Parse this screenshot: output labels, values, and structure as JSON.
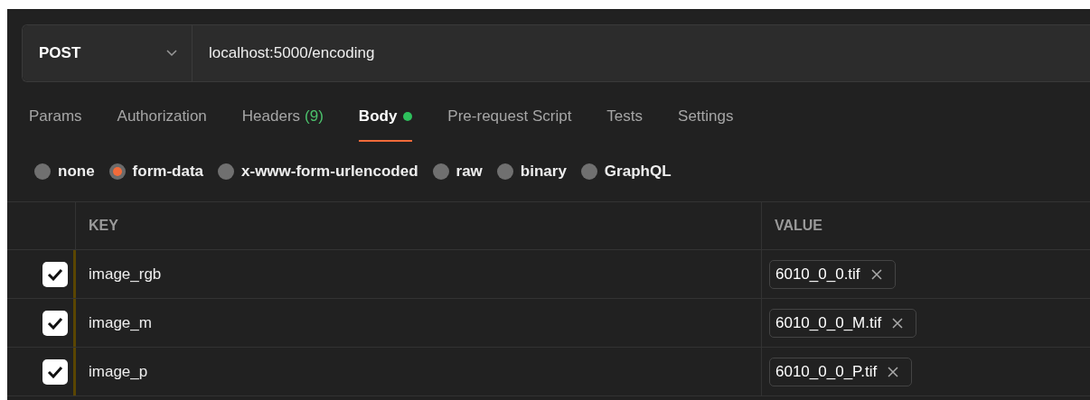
{
  "request": {
    "method": "POST",
    "url": "localhost:5000/encoding"
  },
  "tabs": [
    {
      "label": "Params",
      "selected": false
    },
    {
      "label": "Authorization",
      "selected": false
    },
    {
      "label": "Headers",
      "count": "(9)",
      "selected": false
    },
    {
      "label": "Body",
      "selected": true,
      "dot": true
    },
    {
      "label": "Pre-request Script",
      "selected": false
    },
    {
      "label": "Tests",
      "selected": false
    },
    {
      "label": "Settings",
      "selected": false
    }
  ],
  "body_types": [
    {
      "label": "none",
      "selected": false
    },
    {
      "label": "form-data",
      "selected": true
    },
    {
      "label": "x-www-form-urlencoded",
      "selected": false
    },
    {
      "label": "raw",
      "selected": false
    },
    {
      "label": "binary",
      "selected": false
    },
    {
      "label": "GraphQL",
      "selected": false
    }
  ],
  "table": {
    "columns": [
      "KEY",
      "VALUE"
    ],
    "rows": [
      {
        "checked": true,
        "key": "image_rgb",
        "value": "6010_0_0.tif"
      },
      {
        "checked": true,
        "key": "image_m",
        "value": "6010_0_0_M.tif"
      },
      {
        "checked": true,
        "key": "image_p",
        "value": "6010_0_0_P.tif"
      }
    ]
  }
}
